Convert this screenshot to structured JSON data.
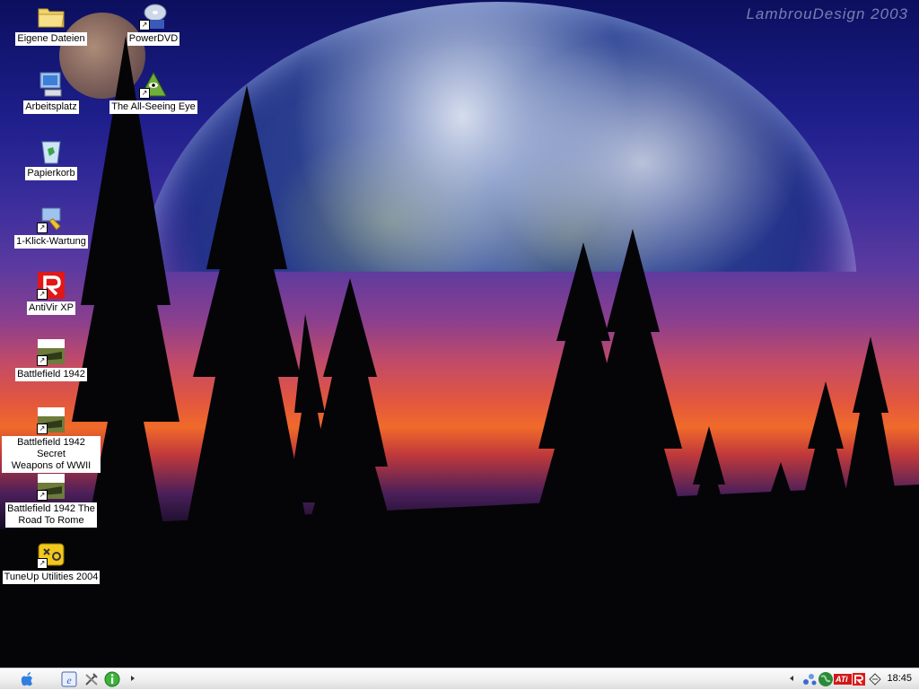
{
  "wallpaper": {
    "watermark": "LambrouDesign 2003"
  },
  "desktop_icons": [
    {
      "label": "Eigene Dateien",
      "icon": "folder-icon",
      "shortcut": false
    },
    {
      "label": "PowerDVD",
      "icon": "dvd-icon",
      "shortcut": true
    },
    {
      "label": "Arbeitsplatz",
      "icon": "computer-icon",
      "shortcut": false
    },
    {
      "label": "The All-Seeing Eye",
      "icon": "pyramid-eye-icon",
      "shortcut": true
    },
    {
      "label": "Papierkorb",
      "icon": "recycle-bin-icon",
      "shortcut": false
    },
    {
      "label": "1-Klick-Wartung",
      "icon": "maintenance-icon",
      "shortcut": true
    },
    {
      "label": "AntiVir XP",
      "icon": "antivir-icon",
      "shortcut": true
    },
    {
      "label": "Battlefield 1942",
      "icon": "battlefield-icon",
      "shortcut": true
    },
    {
      "label": "Battlefield 1942 Secret Weapons of WWII",
      "line1": "Battlefield 1942 Secret",
      "line2": "Weapons of WWII",
      "icon": "battlefield-icon",
      "shortcut": true
    },
    {
      "label": "Battlefield 1942 The Road To Rome",
      "line1": "Battlefield 1942 The",
      "line2": "Road To Rome",
      "icon": "battlefield-icon",
      "shortcut": true
    },
    {
      "label": "TuneUp Utilities 2004",
      "icon": "tuneup-icon",
      "shortcut": true
    }
  ],
  "taskbar": {
    "start_icon": "apple-start-icon",
    "quicklaunch": [
      "ie-icon",
      "tools-icon",
      "info-icon"
    ],
    "tray": [
      "network-icon",
      "globe-icon",
      "ati-icon",
      "antivir-tray-icon",
      "printer-icon"
    ],
    "ati_text": "ATi",
    "clock": "18:45"
  }
}
